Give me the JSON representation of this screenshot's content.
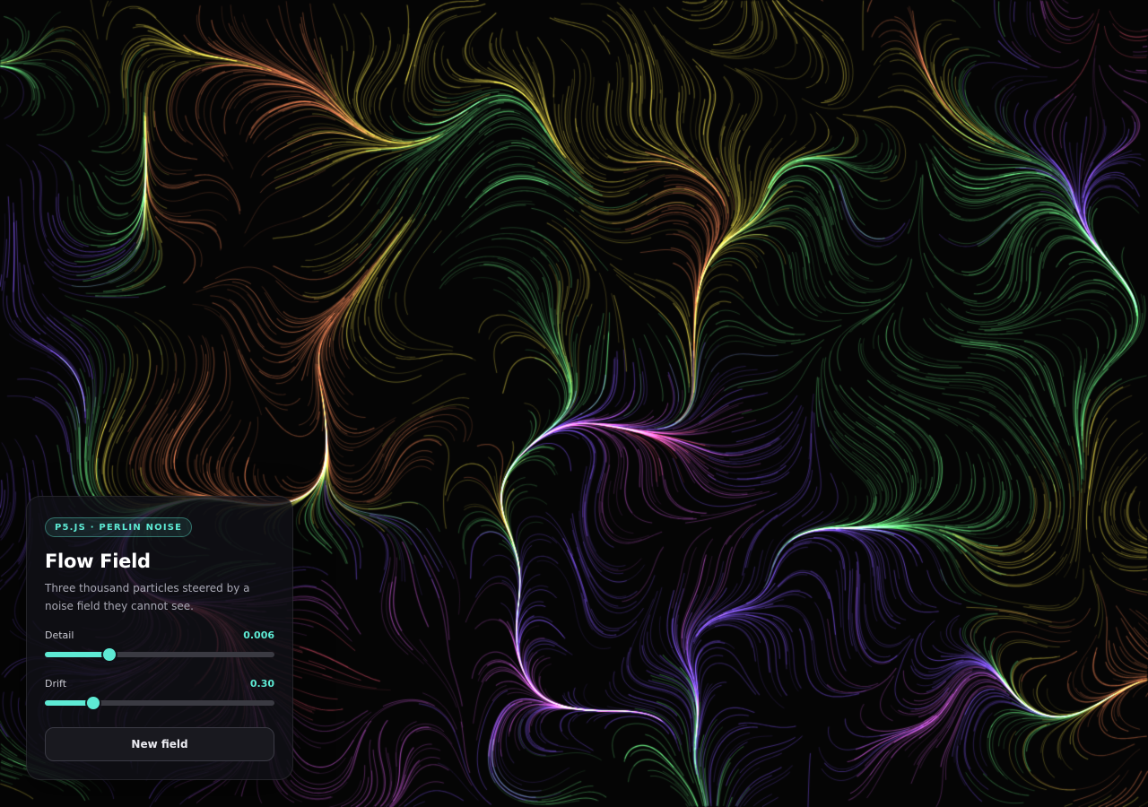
{
  "canvas": {
    "description_free": true,
    "background": "#050505",
    "palette": [
      "#f0506e",
      "#c050d0",
      "#7a4ef0",
      "#5ad070",
      "#d8c840",
      "#e0784a"
    ]
  },
  "panel": {
    "badge": "P5.JS · PERLIN NOISE",
    "title": "Flow Field",
    "description": "Three thousand particles steered by a noise field they cannot see.",
    "accent": "#5eead4",
    "controls": [
      {
        "label": "Detail",
        "value_text": "0.006",
        "level": 0.28
      },
      {
        "label": "Drift",
        "value_text": "0.30",
        "level": 0.21
      }
    ],
    "button_label": "New field"
  }
}
